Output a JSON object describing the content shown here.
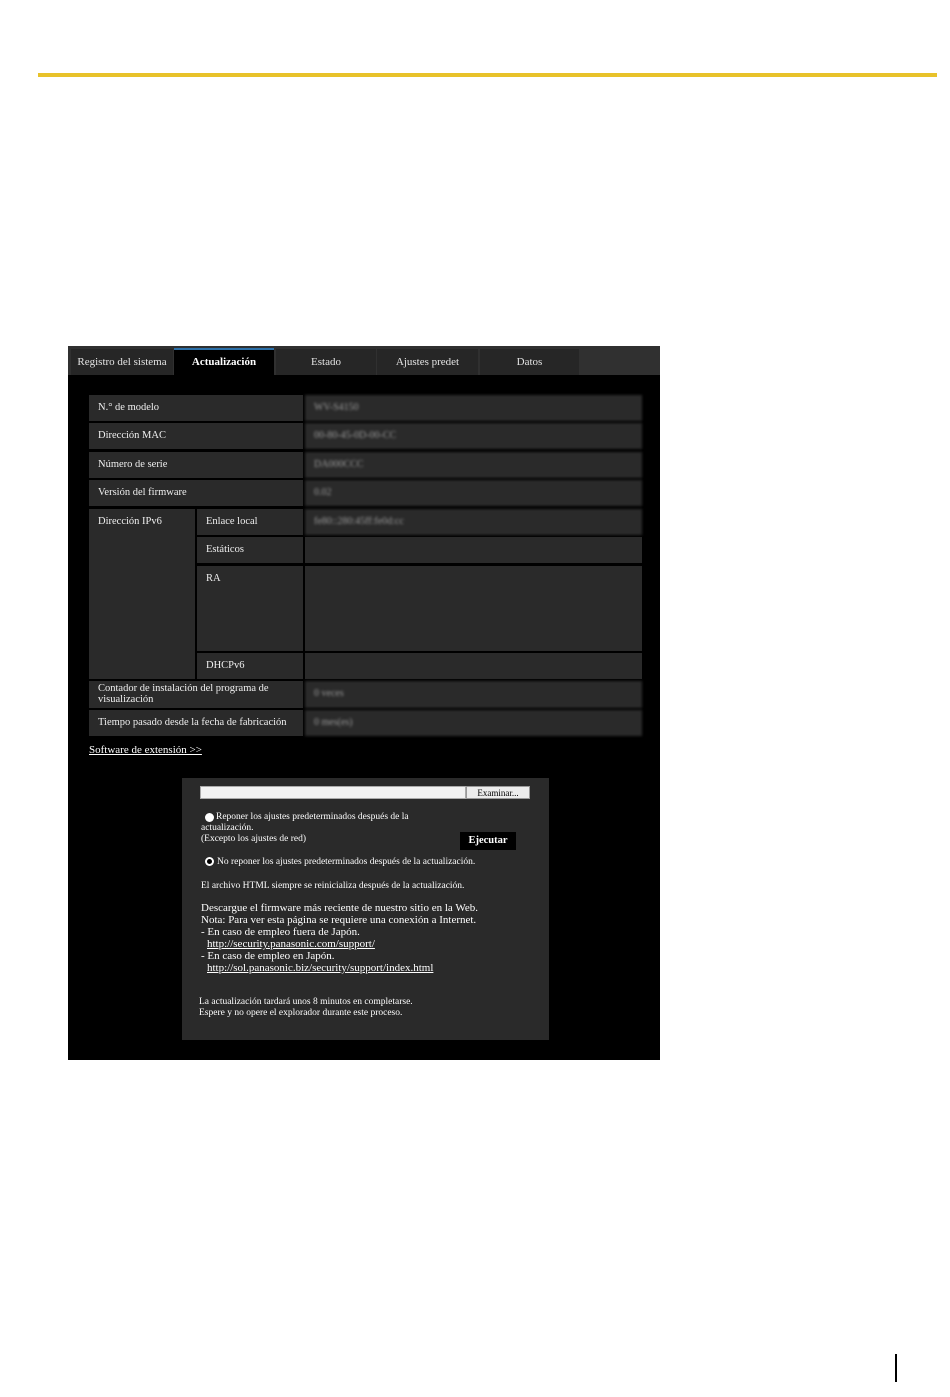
{
  "tabs": [
    {
      "label": "Registro del sistema"
    },
    {
      "label": "Actualización"
    },
    {
      "label": "Estado"
    },
    {
      "label": "Ajustes predet"
    },
    {
      "label": "Datos"
    }
  ],
  "info": {
    "model": {
      "label": "N.° de modelo",
      "value": "WV-S4150"
    },
    "mac": {
      "label": "Dirección MAC",
      "value": "00-80-45-0D-00-CC"
    },
    "serial": {
      "label": "Número de serie",
      "value": "DA000CCC"
    },
    "firmware": {
      "label": "Versión del firmware",
      "value": "0.02"
    },
    "ipv6": {
      "label": "Dirección IPv6",
      "link_local_label": "Enlace local",
      "link_local_value": "fe80::280:45ff:fe0d:cc",
      "static_label": "Estáticos",
      "ra_label": "RA",
      "dhcp_label": "DHCPv6"
    },
    "viewer_counter": {
      "label": "Contador de instalación del programa de visualización",
      "value": "0 veces"
    },
    "elapsed": {
      "label": "Tiempo pasado desde la fecha de fabricación",
      "value": "0 mes(es)"
    }
  },
  "extension_link": "Software de extensión >>",
  "upgrade": {
    "browse_label": "Examinar...",
    "option1_line1": "Reponer los ajustes predeterminados después de la",
    "option1_line2": "actualización.",
    "option1_line3": "(Excepto los ajustes de red)",
    "option2": "No reponer los ajustes predeterminados después de la actualización.",
    "execute_label": "Ejecutar",
    "html_note": "El archivo HTML siempre se reinicializa después de la actualización.",
    "download_line": "Descargue el firmware más reciente de nuestro sitio en la Web.",
    "note_line": "Nota: Para ver esta página se requiere una conexión a Internet.",
    "outside_label": "- En caso de empleo fuera de Japón.",
    "outside_url": "http://security.panasonic.com/support/",
    "japan_label": "- En caso de empleo en Japón.",
    "japan_url": "http://sol.panasonic.biz/security/support/index.html",
    "time_note1": "La actualización tardará unos 8 minutos en completarse.",
    "time_note2": "Espere y no opere el explorador durante este proceso."
  }
}
